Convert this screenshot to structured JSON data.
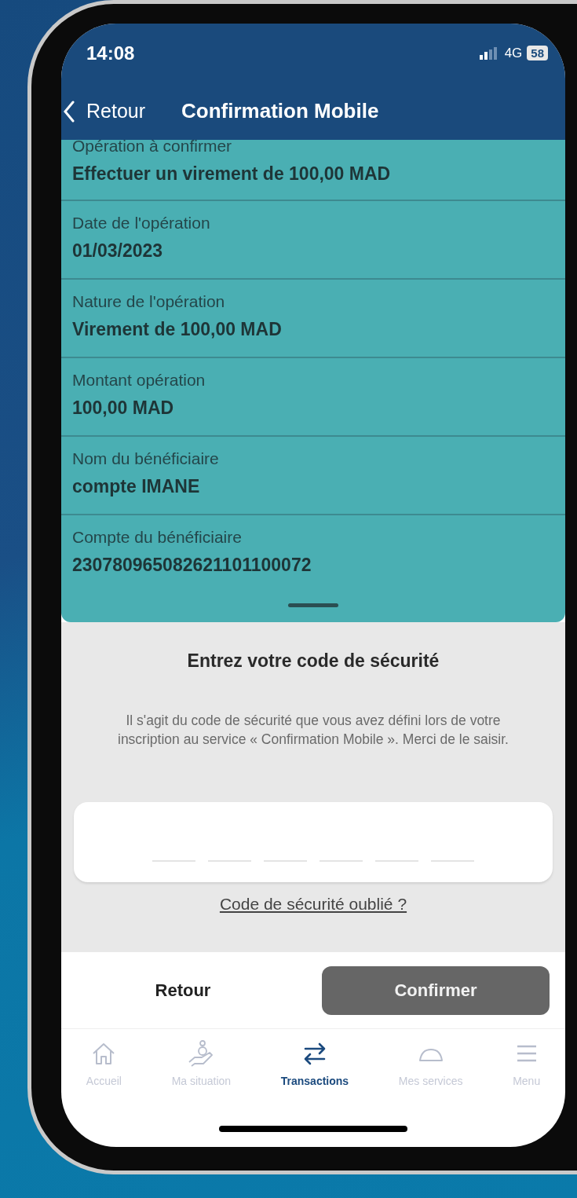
{
  "status_bar": {
    "time": "14:08",
    "network": "4G",
    "battery": "58"
  },
  "nav": {
    "back": "Retour",
    "title": "Confirmation Mobile"
  },
  "details": [
    {
      "label": "Opération à confirmer",
      "value": "Effectuer un virement de 100,00 MAD"
    },
    {
      "label": "Date de l'opération",
      "value": "01/03/2023"
    },
    {
      "label": "Nature de l'opération",
      "value": "Virement de 100,00 MAD"
    },
    {
      "label": "Montant opération",
      "value": "100,00 MAD"
    },
    {
      "label": "Nom du bénéficiaire",
      "value": "compte IMANE"
    },
    {
      "label": "Compte du bénéficiaire",
      "value": "230780965082621101100072"
    }
  ],
  "sheet": {
    "title": "Entrez votre code de sécurité",
    "description": "Il s'agit du code de sécurité que vous avez défini lors de votre inscription au service « Confirmation Mobile ». Merci de le saisir.",
    "forgot_link": "Code de sécurité oublié ?"
  },
  "buttons": [
    {
      "label": "Retour",
      "kind": "plain",
      "disabled": false
    },
    {
      "label": "Confirmer",
      "kind": "filled",
      "disabled": true
    }
  ],
  "tabs": [
    {
      "label": "Accueil",
      "kind": "house",
      "selected": false
    },
    {
      "label": "Ma situation",
      "kind": "hand",
      "selected": false
    },
    {
      "label": "Transactions",
      "kind": "arrows",
      "selected": true
    },
    {
      "label": "Mes services",
      "kind": "cloche",
      "selected": false
    },
    {
      "label": "Menu",
      "kind": "lines",
      "selected": false
    }
  ]
}
